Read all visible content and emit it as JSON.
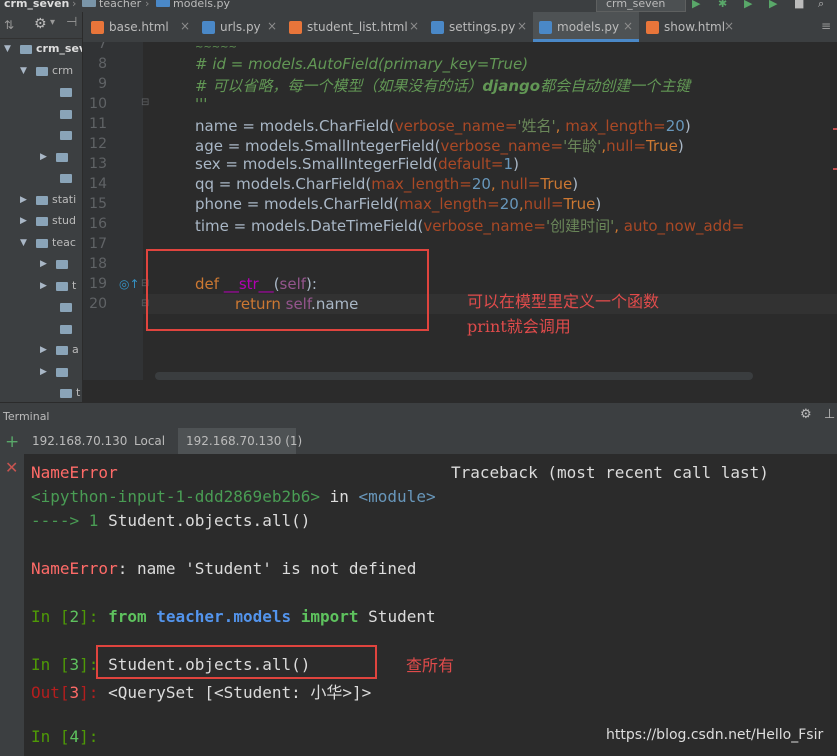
{
  "breadcrumb": {
    "project": "crm_seven",
    "folder": "teacher",
    "file": "models.py",
    "run_config": "crm_seven"
  },
  "sidebar": {
    "items": [
      {
        "label": "crm_sev",
        "arrow": "▼"
      },
      {
        "label": "crm",
        "arrow": "▼"
      },
      {
        "label": "",
        "arrow": ""
      },
      {
        "label": "",
        "arrow": ""
      },
      {
        "label": "",
        "arrow": ""
      },
      {
        "label": "",
        "arrow": "▶"
      },
      {
        "label": "",
        "arrow": ""
      },
      {
        "label": "stati",
        "arrow": "▶"
      },
      {
        "label": "stud",
        "arrow": "▶"
      },
      {
        "label": "teac",
        "arrow": "▼"
      },
      {
        "label": "",
        "arrow": "▶"
      },
      {
        "label": "t",
        "arrow": "▶"
      },
      {
        "label": "",
        "arrow": ""
      },
      {
        "label": "",
        "arrow": ""
      },
      {
        "label": "a",
        "arrow": "▶"
      },
      {
        "label": "",
        "arrow": "▶"
      },
      {
        "label": "t",
        "arrow": ""
      },
      {
        "label": "",
        "arrow": ""
      }
    ]
  },
  "tabs": [
    {
      "label": "base.html",
      "color": "#e8753a"
    },
    {
      "label": "urls.py",
      "color": "#4a88c7"
    },
    {
      "label": "student_list.html",
      "color": "#e8753a"
    },
    {
      "label": "settings.py",
      "color": "#4a88c7"
    },
    {
      "label": "models.py",
      "color": "#4a88c7"
    },
    {
      "label": "show.html",
      "color": "#e8753a"
    }
  ],
  "editor": {
    "line_numbers": [
      "7",
      "8",
      "9",
      "10",
      "11",
      "12",
      "13",
      "14",
      "15",
      "16",
      "17",
      "18",
      "19",
      "20"
    ],
    "lines": {
      "l7": "~~~~~",
      "l8": "# id = models.AutoField(primary_key=True)",
      "l9a": "# 可以省略，每一个模型（如果没有的话）",
      "l9b": "django",
      "l9c": "都会自动创建一个主键",
      "l10": "'''",
      "l11a": "name",
      "l11b": " = models.CharField(",
      "l11c": "verbose_name=",
      "l11d": "'姓名'",
      "l11e": ", ",
      "l11f": "max_length=",
      "l11g": "20",
      "l11h": ")",
      "l12a": "age = models.SmallIntegerField(",
      "l12b": "verbose_name=",
      "l12c": "'年龄'",
      "l12d": ",",
      "l12e": "null=",
      "l12f": "True",
      "l12g": ")",
      "l13a": "sex = models.SmallIntegerField(",
      "l13b": "default=",
      "l13c": "1",
      "l13d": ")",
      "l14a": "qq = models.CharField(",
      "l14b": "max_length=",
      "l14c": "20",
      "l14d": ", ",
      "l14e": "null=",
      "l14f": "True",
      "l14g": ")",
      "l15a": "phone = models.CharField(",
      "l15b": "max_length=",
      "l15c": "20",
      "l15d": ",",
      "l15e": "null=",
      "l15f": "True",
      "l15g": ")",
      "l16a": "time = models.DateTimeField(",
      "l16b": "verbose_name=",
      "l16c": "'创建时间'",
      "l16d": ", ",
      "l16e": "auto_now_add=",
      "l19a": "def ",
      "l19b": "__str__",
      "l19c": "(",
      "l19d": "self",
      "l19e": "):",
      "l20a": "return ",
      "l20b": "self",
      "l20c": ".name"
    },
    "annotation_line1": "可以在模型里定义一个函数",
    "annotation_line2": "print就会调用"
  },
  "terminal": {
    "title": "Terminal",
    "tabs": [
      "192.168.70.130",
      "Local",
      "192.168.70.130 (1)"
    ],
    "lines": {
      "t1a": "NameError",
      "t1b": "Traceback (most recent call last)",
      "t2a": "<ipython-input-1-ddd2869eb2b6>",
      "t2b": " in ",
      "t2c": "<module>",
      "t3a": "----> 1 ",
      "t3b": "Student.objects.all()",
      "t4a": "NameError",
      "t4b": ": name 'Student' is not defined",
      "t5a": "In [",
      "t5b": "2",
      "t5c": "]: ",
      "t5d": "from ",
      "t5e": "teacher.models",
      "t5f": " import ",
      "t5g": "Student",
      "t6a": "In [",
      "t6b": "3",
      "t6c": "]: ",
      "t6d": "Student.objects.all()",
      "t7a": "Out[",
      "t7b": "3",
      "t7c": "]: ",
      "t7d": "<QuerySet [<Student: 小华>]>",
      "t8a": "In [",
      "t8b": "4",
      "t8c": "]:"
    },
    "annotation": "查所有"
  },
  "watermark": "https://blog.csdn.net/Hello_Fsir"
}
